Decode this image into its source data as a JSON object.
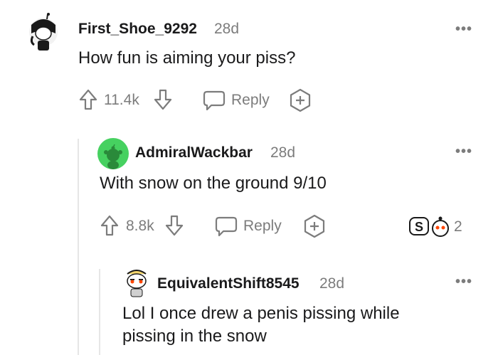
{
  "comments": [
    {
      "username": "First_Shoe_9292",
      "age": "28d",
      "text": "How fun is aiming your piss?",
      "votes": "11.4k",
      "reply_label": "Reply",
      "more": "•••"
    },
    {
      "username": "AdmiralWackbar",
      "age": "28d",
      "text": "With snow on the ground 9/10",
      "votes": "8.8k",
      "reply_label": "Reply",
      "more": "•••",
      "award_count": "2"
    },
    {
      "username": "EquivalentShift8545",
      "age": "28d",
      "text_line1": "Lol I once drew a penis pissing while",
      "text_line2": "pissing in the snow",
      "more": "•••"
    }
  ],
  "colors": {
    "text": "#1a1a1b",
    "meta": "#7c7c7c",
    "thread_line": "#e6e6e6",
    "snoo_green": "#46d160"
  },
  "icons": [
    "upvote-icon",
    "downvote-icon",
    "reply-icon",
    "award-icon",
    "more-icon"
  ]
}
